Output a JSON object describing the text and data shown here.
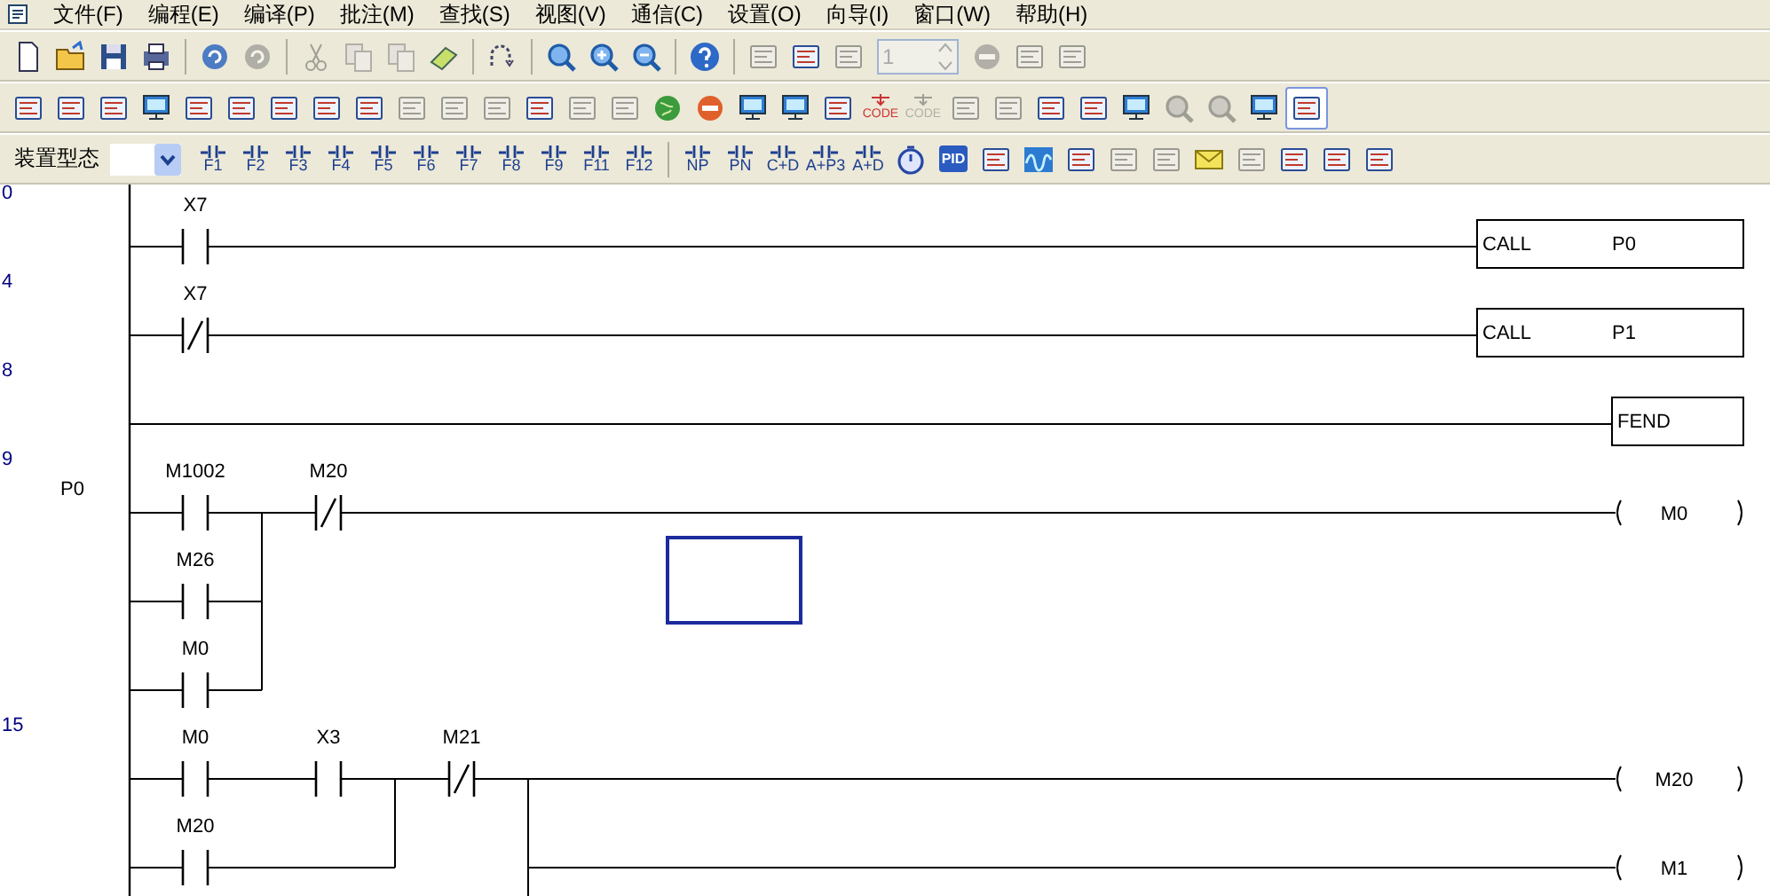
{
  "menu": [
    "文件(F)",
    "编程(E)",
    "编译(P)",
    "批注(M)",
    "查找(S)",
    "视图(V)",
    "通信(C)",
    "设置(O)",
    "向导(I)",
    "窗口(W)",
    "帮助(H)"
  ],
  "toolbars": [
    [
      {
        "kind": "doc",
        "disabled": false
      },
      {
        "kind": "folder",
        "disabled": false
      },
      {
        "kind": "floppy",
        "disabled": false
      },
      {
        "kind": "printer",
        "disabled": false
      },
      {
        "kind": "sep"
      },
      {
        "kind": "undo",
        "disabled": false
      },
      {
        "kind": "redo",
        "disabled": true
      },
      {
        "kind": "sep"
      },
      {
        "kind": "scissors",
        "disabled": true
      },
      {
        "kind": "copy",
        "disabled": true
      },
      {
        "kind": "paste",
        "disabled": true
      },
      {
        "kind": "eraser",
        "disabled": false
      },
      {
        "kind": "sep"
      },
      {
        "kind": "jump",
        "disabled": false
      },
      {
        "kind": "sep"
      },
      {
        "kind": "search",
        "disabled": false
      },
      {
        "kind": "zoomin",
        "disabled": false
      },
      {
        "kind": "zoomout",
        "disabled": false
      },
      {
        "kind": "sep"
      },
      {
        "kind": "help",
        "disabled": false
      },
      {
        "kind": "sep"
      },
      {
        "kind": "tool",
        "disabled": true
      },
      {
        "kind": "tool",
        "disabled": false
      },
      {
        "kind": "tool",
        "disabled": true
      },
      {
        "kind": "spin",
        "value": "1",
        "disabled": true
      },
      {
        "kind": "stop",
        "disabled": true
      },
      {
        "kind": "tool",
        "disabled": true
      },
      {
        "kind": "tool",
        "disabled": true
      }
    ],
    [
      {
        "kind": "tool",
        "disabled": false,
        "selected": false
      },
      {
        "kind": "tool",
        "disabled": false,
        "selected": false
      },
      {
        "kind": "tool",
        "disabled": false,
        "selected": false
      },
      {
        "kind": "monitor",
        "disabled": false,
        "selected": false
      },
      {
        "kind": "tool",
        "disabled": false,
        "selected": false
      },
      {
        "kind": "tool",
        "disabled": false,
        "selected": false
      },
      {
        "kind": "tool",
        "disabled": false,
        "selected": false
      },
      {
        "kind": "tool",
        "disabled": false,
        "selected": false
      },
      {
        "kind": "tool",
        "disabled": false,
        "selected": false
      },
      {
        "kind": "tool",
        "disabled": true,
        "selected": false
      },
      {
        "kind": "tool",
        "disabled": true,
        "selected": false
      },
      {
        "kind": "tool",
        "disabled": true,
        "selected": false
      },
      {
        "kind": "tool",
        "disabled": false,
        "selected": false
      },
      {
        "kind": "tool",
        "disabled": true,
        "selected": false
      },
      {
        "kind": "tool",
        "disabled": true,
        "selected": false
      },
      {
        "kind": "globe",
        "disabled": false,
        "selected": false
      },
      {
        "kind": "stop",
        "disabled": false,
        "selected": false
      },
      {
        "kind": "monitor",
        "disabled": false,
        "selected": false
      },
      {
        "kind": "monitor",
        "disabled": false,
        "selected": false
      },
      {
        "kind": "tool",
        "disabled": false,
        "selected": false
      },
      {
        "kind": "code",
        "caption": "CODE",
        "disabled": false,
        "selected": false
      },
      {
        "kind": "code",
        "caption": "CODE",
        "disabled": true,
        "selected": false
      },
      {
        "kind": "tool",
        "disabled": true,
        "selected": false
      },
      {
        "kind": "tool",
        "disabled": true,
        "selected": false
      },
      {
        "kind": "tool",
        "disabled": false,
        "selected": false
      },
      {
        "kind": "tool",
        "disabled": false,
        "selected": false
      },
      {
        "kind": "monitor",
        "disabled": false,
        "selected": false
      },
      {
        "kind": "search",
        "disabled": true,
        "selected": false
      },
      {
        "kind": "search",
        "disabled": true,
        "selected": false
      },
      {
        "kind": "monitor",
        "disabled": false,
        "selected": false
      },
      {
        "kind": "tool",
        "disabled": false,
        "selected": true
      }
    ],
    [
      {
        "kind": "label",
        "text": "装置型态"
      },
      {
        "kind": "dropdown"
      },
      {
        "kind": "fkey",
        "caption": "F1",
        "disabled": false
      },
      {
        "kind": "fkey",
        "caption": "F2",
        "disabled": false
      },
      {
        "kind": "fkey",
        "caption": "F3",
        "disabled": false
      },
      {
        "kind": "fkey",
        "caption": "F4",
        "disabled": false
      },
      {
        "kind": "fkey",
        "caption": "F5",
        "disabled": false
      },
      {
        "kind": "fkey",
        "caption": "F6",
        "disabled": false
      },
      {
        "kind": "fkey",
        "caption": "F7",
        "disabled": false
      },
      {
        "kind": "fkey",
        "caption": "F8",
        "disabled": false
      },
      {
        "kind": "fkey",
        "caption": "F9",
        "disabled": false
      },
      {
        "kind": "fkey",
        "caption": "F11",
        "disabled": false
      },
      {
        "kind": "fkey",
        "caption": "F12",
        "disabled": false
      },
      {
        "kind": "sep"
      },
      {
        "kind": "fkey",
        "caption": "NP",
        "disabled": false
      },
      {
        "kind": "fkey",
        "caption": "PN",
        "disabled": false
      },
      {
        "kind": "fkey",
        "caption": "C+D",
        "disabled": false
      },
      {
        "kind": "fkey",
        "caption": "A+P3",
        "disabled": false
      },
      {
        "kind": "fkey",
        "caption": "A+D",
        "disabled": false
      },
      {
        "kind": "timer",
        "disabled": false
      },
      {
        "kind": "pid",
        "caption": "PID",
        "disabled": false
      },
      {
        "kind": "tool",
        "disabled": false
      },
      {
        "kind": "wave",
        "disabled": false
      },
      {
        "kind": "tool",
        "disabled": false
      },
      {
        "kind": "tool",
        "disabled": true
      },
      {
        "kind": "tool",
        "disabled": true
      },
      {
        "kind": "envelope",
        "disabled": false
      },
      {
        "kind": "tool",
        "disabled": true
      },
      {
        "kind": "tool",
        "disabled": false
      },
      {
        "kind": "tool",
        "disabled": false
      },
      {
        "kind": "tool",
        "disabled": false
      }
    ]
  ],
  "ladder": {
    "rungs": [
      {
        "step": "0",
        "blocks": [
          {
            "paths": [
              [
                {
                  "kind": "no",
                  "label": "X7"
                }
              ]
            ]
          }
        ],
        "outputs": [
          {
            "kind": "call",
            "op": "CALL",
            "arg": "P0"
          }
        ]
      },
      {
        "step": "4",
        "blocks": [
          {
            "paths": [
              [
                {
                  "kind": "nc",
                  "label": "X7"
                }
              ]
            ]
          }
        ],
        "outputs": [
          {
            "kind": "call",
            "op": "CALL",
            "arg": "P1"
          }
        ]
      },
      {
        "step": "8",
        "outputs": [
          {
            "kind": "fend",
            "op": "FEND"
          }
        ]
      },
      {
        "step": "9",
        "pointer": "P0",
        "blocks": [
          {
            "paths": [
              [
                {
                  "kind": "no",
                  "label": "M1002"
                }
              ],
              [
                {
                  "kind": "no",
                  "label": "M26"
                }
              ],
              [
                {
                  "kind": "no",
                  "label": "M0"
                }
              ]
            ]
          },
          {
            "paths": [
              [
                {
                  "kind": "nc",
                  "label": "M20"
                }
              ]
            ]
          }
        ],
        "outputs": [
          {
            "kind": "coil",
            "name": "M0"
          }
        ]
      },
      {
        "step": "15",
        "blocks": [
          {
            "paths": [
              [
                {
                  "kind": "no",
                  "label": "M0"
                },
                {
                  "kind": "no",
                  "label": "X3"
                }
              ],
              [
                {
                  "kind": "no",
                  "label": "M20"
                }
              ]
            ]
          },
          {
            "paths": [
              [
                {
                  "kind": "nc",
                  "label": "M21"
                }
              ]
            ]
          }
        ],
        "outputs": [
          {
            "kind": "coil",
            "name": "M20"
          },
          {
            "kind": "coil",
            "name": "M1"
          }
        ]
      }
    ]
  }
}
